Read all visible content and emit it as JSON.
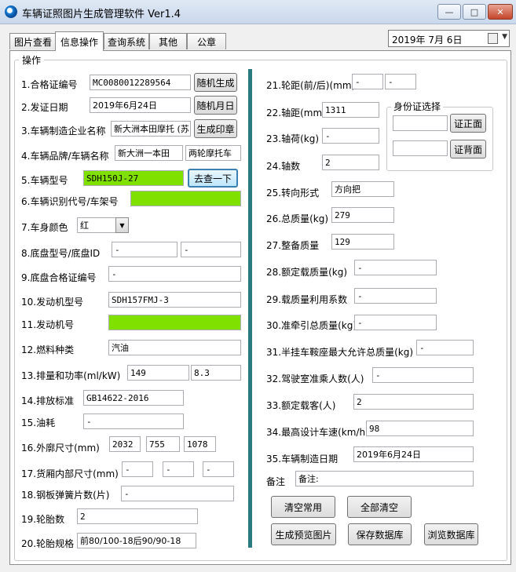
{
  "window": {
    "title": "车辆证照图片生成管理软件 Ver1.4",
    "controls": {
      "minimize": "—",
      "maximize": "□",
      "close": "✕"
    }
  },
  "tabs": [
    "图片查看",
    "信息操作",
    "查询系统",
    "其他",
    "公章"
  ],
  "date_picker": {
    "value": "2019年  7月  6日"
  },
  "group_title": "操作",
  "left": {
    "f1": {
      "label": "1.合格证编号",
      "value": "MC0080012289564",
      "button": "随机生成"
    },
    "f2": {
      "label": "2.发证日期",
      "value": "2019年6月24日",
      "button": "随机月日"
    },
    "f3": {
      "label": "3.车辆制造企业名称",
      "value": "新大洲本田摩托 (苏",
      "button": "生成印章"
    },
    "f4": {
      "label": "4.车辆品牌/车辆名称",
      "value1": "新大洲一本田",
      "value2": "两轮摩托车"
    },
    "f5": {
      "label": "5.车辆型号",
      "value": "SDH150J-27",
      "button": "去查一下"
    },
    "f6": {
      "label": "6.车辆识别代号/车架号",
      "value": ""
    },
    "f7": {
      "label": "7.车身颜色",
      "value": "红"
    },
    "f8": {
      "label": "8.底盘型号/底盘ID",
      "value1": "-",
      "value2": "-"
    },
    "f9": {
      "label": "9.底盘合格证编号",
      "value": "-"
    },
    "f10": {
      "label": "10.发动机型号",
      "value": "SDH157FMJ-3"
    },
    "f11": {
      "label": "11.发动机号",
      "value": ""
    },
    "f12": {
      "label": "12.燃料种类",
      "value": "汽油"
    },
    "f13": {
      "label": "13.排量和功率(ml/kW)",
      "value1": "149",
      "value2": "8.3"
    },
    "f14": {
      "label": "14.排放标准",
      "value": "GB14622-2016"
    },
    "f15": {
      "label": "15.油耗",
      "value": "-"
    },
    "f16": {
      "label": "16.外廓尺寸(mm)",
      "value1": "2032",
      "value2": "755",
      "value3": "1078"
    },
    "f17": {
      "label": "17.货厢内部尺寸(mm)",
      "value1": "-",
      "value2": "-",
      "value3": "-"
    },
    "f18": {
      "label": "18.钢板弹簧片数(片)",
      "value": "-"
    },
    "f19": {
      "label": "19.轮胎数",
      "value": "2"
    },
    "f20": {
      "label": "20.轮胎规格",
      "value": "前80/100-18后90/90-18"
    }
  },
  "right": {
    "f21": {
      "label": "21.轮距(前/后)(mm)",
      "value1": "-",
      "value2": "-"
    },
    "f22": {
      "label": "22.轴距(mm)",
      "value": "1311"
    },
    "f23": {
      "label": "23.轴荷(kg)",
      "value": "-"
    },
    "f24": {
      "label": "24.轴数",
      "value": "2"
    },
    "f25": {
      "label": "25.转向形式",
      "value": "方向把"
    },
    "f26": {
      "label": "26.总质量(kg)",
      "value": "279"
    },
    "f27": {
      "label": "27.整备质量",
      "value": "129"
    },
    "f28": {
      "label": "28.额定载质量(kg)",
      "value": "-"
    },
    "f29": {
      "label": "29.载质量利用系数",
      "value": "-"
    },
    "f30": {
      "label": "30.准牵引总质量(kg)",
      "value": "-"
    },
    "f31": {
      "label": "31.半挂车鞍座最大允许总质量(kg)",
      "value": "-"
    },
    "f32": {
      "label": "32.驾驶室准乘人数(人)",
      "value": "-"
    },
    "f33": {
      "label": "33.额定载客(人)",
      "value": "2"
    },
    "f34": {
      "label": "34.最高设计车速(km/h",
      "value": "98"
    },
    "f35": {
      "label": "35.车辆制造日期",
      "value": "2019年6月24日"
    },
    "remark": {
      "label": "备注",
      "value": "备注:"
    }
  },
  "id_card": {
    "title": "身份证选择",
    "front_value": "",
    "back_value": "",
    "front_button": "证正面",
    "back_button": "证背面"
  },
  "actions": {
    "clear_common": "清空常用",
    "clear_all": "全部清空",
    "generate_preview": "生成预览图片",
    "save_db": "保存数据库",
    "browse_db": "浏览数据库"
  }
}
